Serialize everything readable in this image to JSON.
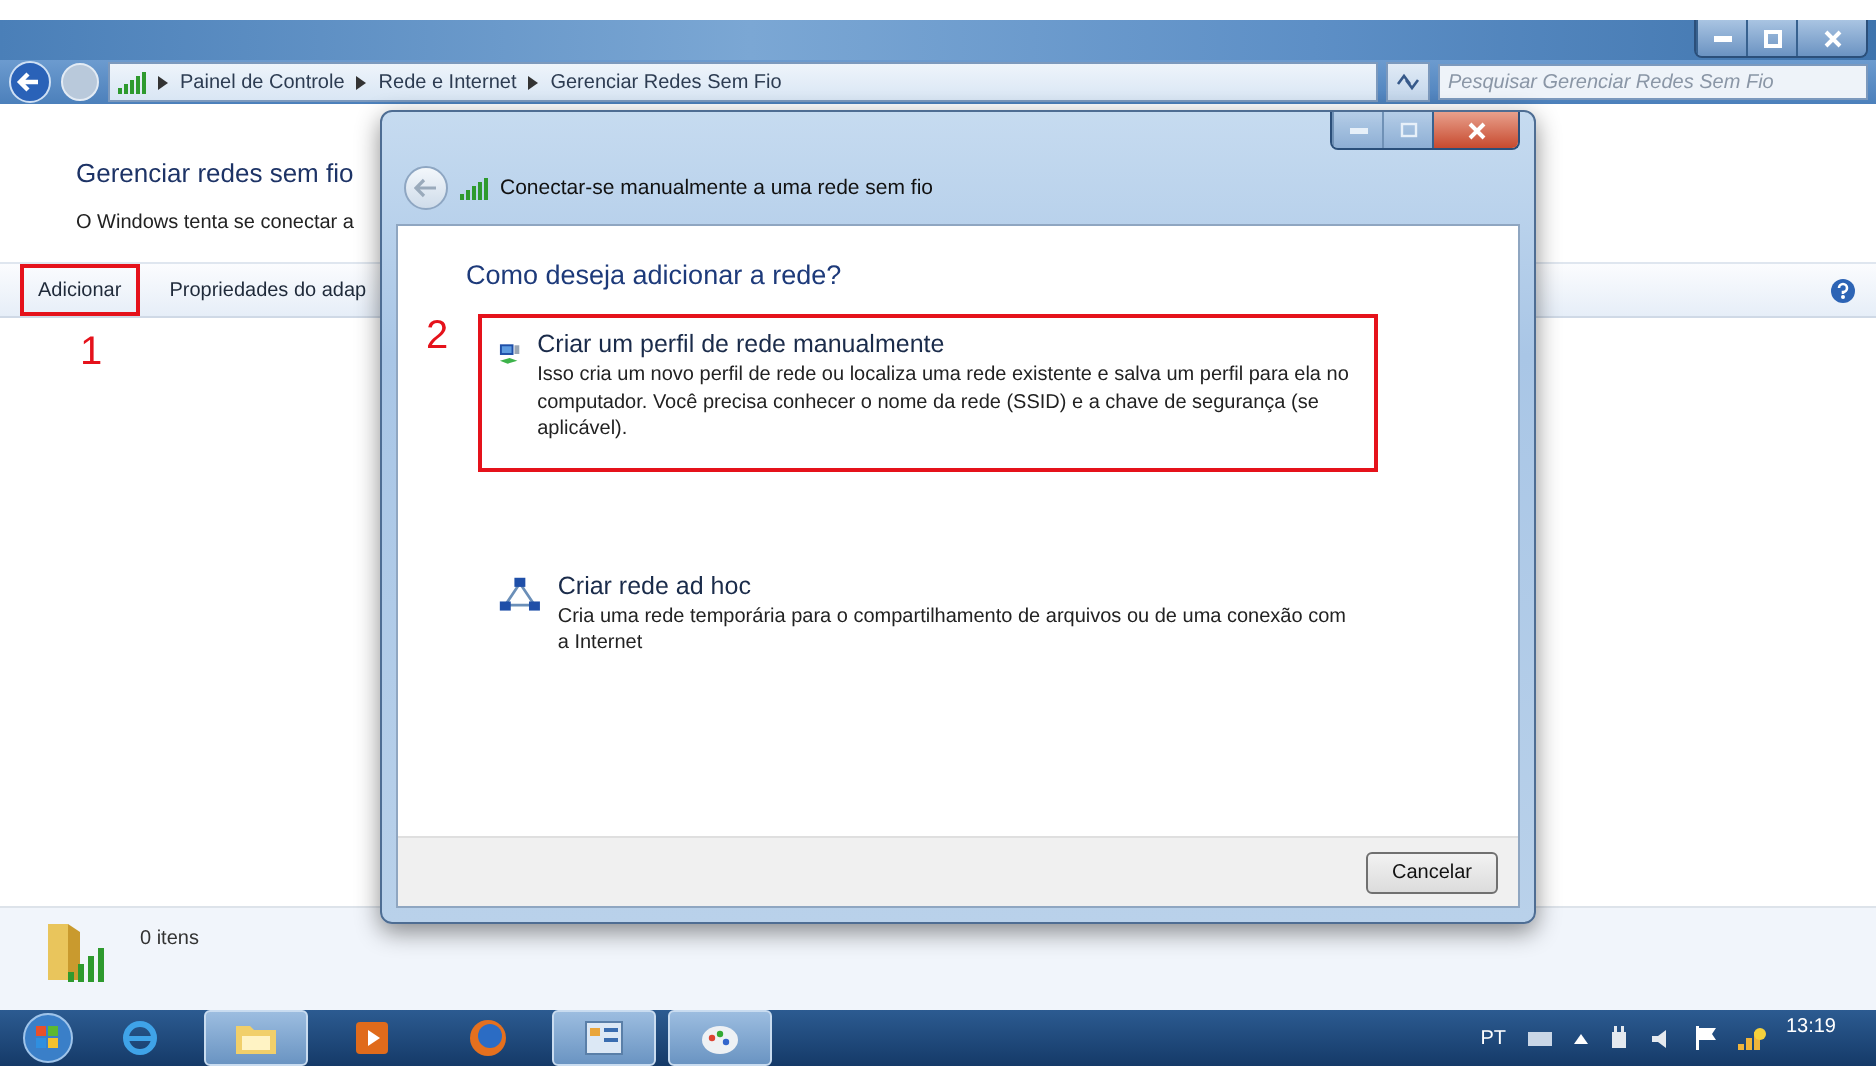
{
  "window": {
    "breadcrumb": [
      "Painel de Controle",
      "Rede e Internet",
      "Gerenciar Redes Sem Fio"
    ],
    "search": {
      "placeholder": "Pesquisar Gerenciar Redes Sem Fio"
    }
  },
  "page": {
    "title": "Gerenciar redes sem fio",
    "description": "O Windows tenta se conectar a"
  },
  "toolbar": [
    {
      "label": "Adicionar",
      "highlighted": true,
      "marker": "1"
    },
    {
      "label": "Propriedades do adap",
      "highlighted": false
    }
  ],
  "status_bar": {
    "text": "0 itens"
  },
  "dialog": {
    "title": "Conectar-se manualmente a uma rede sem fio",
    "question": "Como deseja adicionar a rede?",
    "options": [
      {
        "kind": "profile",
        "title": "Criar um perfil de rede manualmente",
        "description": "Isso cria um novo perfil de rede ou localiza uma rede existente e salva um perfil para ela no computador. Você precisa conhecer o nome da rede (SSID) e a chave de segurança (se aplicável).",
        "highlighted": true,
        "marker": "2"
      },
      {
        "kind": "adhoc",
        "title": "Criar rede ad hoc",
        "description": "Cria uma rede temporária para o compartilhamento de arquivos ou de uma conexão com a Internet",
        "highlighted": false
      }
    ],
    "buttons": [
      "Cancelar"
    ]
  },
  "taskbar": {
    "apps": [
      {
        "kind": "browser",
        "active": false
      },
      {
        "kind": "folder",
        "active": true
      },
      {
        "kind": "player",
        "active": false
      },
      {
        "kind": "globe",
        "active": false
      },
      {
        "kind": "panel",
        "active": true
      },
      {
        "kind": "paint",
        "active": true
      }
    ],
    "tray": {
      "language": "PT",
      "time": "13:19"
    }
  }
}
